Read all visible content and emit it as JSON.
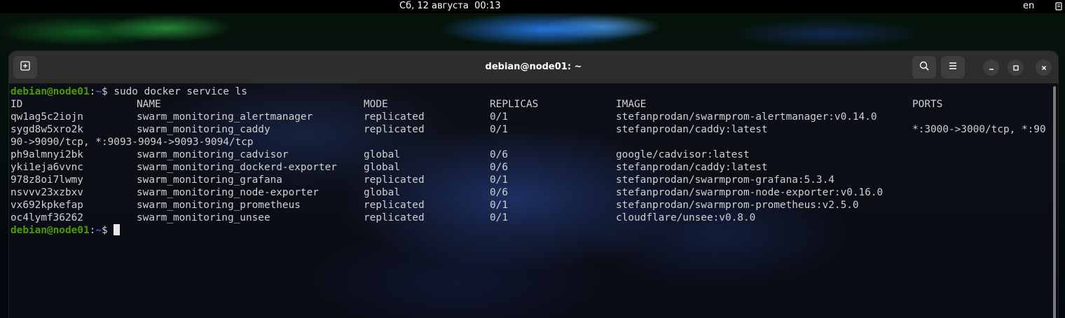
{
  "topbar": {
    "clock": "Сб, 12 августа  00:13",
    "lang": "en"
  },
  "window": {
    "title": "debian@node01: ~"
  },
  "prompt": {
    "user_host": "debian@node01",
    "colon": ":",
    "path": "~",
    "symbol": "$"
  },
  "command": " sudo docker service ls",
  "table": {
    "headers": {
      "id": "ID",
      "name": "NAME",
      "mode": "MODE",
      "replicas": "REPLICAS",
      "image": "IMAGE",
      "ports": "PORTS"
    },
    "rows": [
      {
        "id": "qw1ag5c2iojn",
        "name": "swarm_monitoring_alertmanager",
        "mode": "replicated",
        "replicas": "0/1",
        "image": "stefanprodan/swarmprom-alertmanager:v0.14.0",
        "ports": ""
      },
      {
        "id": "sygd8w5xro2k",
        "name": "swarm_monitoring_caddy",
        "mode": "replicated",
        "replicas": "0/1",
        "image": "stefanprodan/caddy:latest",
        "ports": "*:3000->3000/tcp, *:90"
      },
      {
        "id": "ph9almnyi2bk",
        "name": "swarm_monitoring_cadvisor",
        "mode": "global",
        "replicas": "0/6",
        "image": "google/cadvisor:latest",
        "ports": ""
      },
      {
        "id": "yki1eja6vvnc",
        "name": "swarm_monitoring_dockerd-exporter",
        "mode": "global",
        "replicas": "0/6",
        "image": "stefanprodan/caddy:latest",
        "ports": ""
      },
      {
        "id": "978z8oi7lwmy",
        "name": "swarm_monitoring_grafana",
        "mode": "replicated",
        "replicas": "0/1",
        "image": "stefanprodan/swarmprom-grafana:5.3.4",
        "ports": ""
      },
      {
        "id": "nsvvv23xzbxv",
        "name": "swarm_monitoring_node-exporter",
        "mode": "global",
        "replicas": "0/6",
        "image": "stefanprodan/swarmprom-node-exporter:v0.16.0",
        "ports": ""
      },
      {
        "id": "vx692kpkefap",
        "name": "swarm_monitoring_prometheus",
        "mode": "replicated",
        "replicas": "0/1",
        "image": "stefanprodan/swarmprom-prometheus:v2.5.0",
        "ports": ""
      },
      {
        "id": "oc4lymf36262",
        "name": "swarm_monitoring_unsee",
        "mode": "replicated",
        "replicas": "0/1",
        "image": "cloudflare/unsee:v0.8.0",
        "ports": ""
      }
    ],
    "wrap_line": "90->9090/tcp, *:9093-9094->9093-9094/tcp"
  },
  "colors": {
    "prompt_user": "#4e9a06",
    "prompt_path": "#3465a4",
    "text": "#d0d0d0",
    "titlebar": "#2d2d2d"
  },
  "icons": {
    "new_tab": "new-tab-icon",
    "search": "search-icon",
    "menu": "hamburger-menu-icon",
    "minimize": "minimize-icon",
    "maximize": "maximize-icon",
    "close": "close-icon"
  }
}
